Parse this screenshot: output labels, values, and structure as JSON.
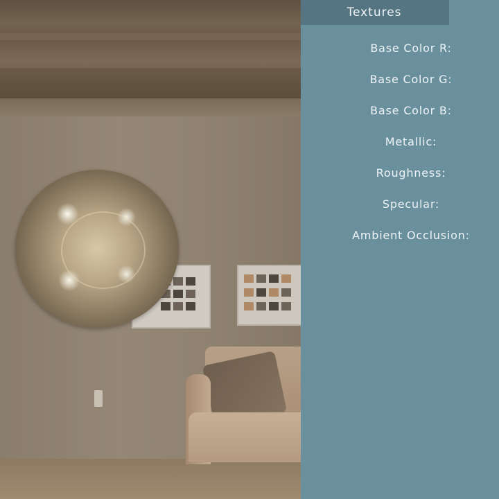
{
  "panel": {
    "tab_label": "Textures",
    "properties": [
      {
        "label": "Base Color R:"
      },
      {
        "label": "Base Color G:"
      },
      {
        "label": "Base Color B:"
      },
      {
        "label": "Metallic:"
      },
      {
        "label": "Roughness:"
      },
      {
        "label": "Specular:"
      },
      {
        "label": "Ambient Occlusion:"
      }
    ]
  },
  "colors": {
    "panel_bg": "#6a909e",
    "tab_bg": "#557582",
    "text": "#eef3f5"
  }
}
